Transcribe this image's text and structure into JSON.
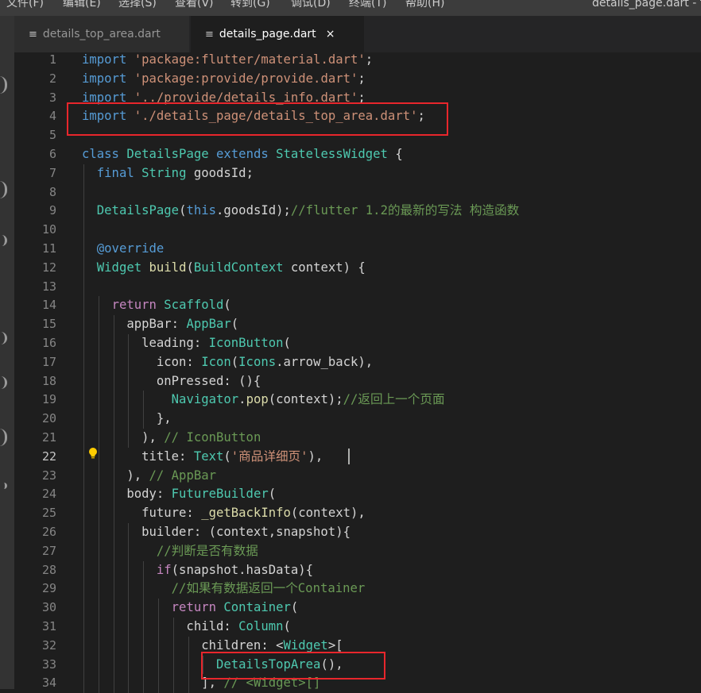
{
  "menu": {
    "items": [
      "文件(F)",
      "编辑(E)",
      "选择(S)",
      "查看(V)",
      "转到(G)",
      "调试(D)",
      "终端(T)",
      "帮助(H)"
    ],
    "window_title": "details_page.dart - flu"
  },
  "tabs": [
    {
      "label": "details_top_area.dart",
      "active": false
    },
    {
      "label": "details_page.dart",
      "active": true,
      "close": "×"
    }
  ],
  "editor": {
    "active_line": 22,
    "lines": [
      {
        "n": "1",
        "tokens": [
          [
            "import",
            "k"
          ],
          [
            " ",
            "p"
          ],
          [
            "'package:flutter/material.dart'",
            "s"
          ],
          [
            ";",
            "p"
          ]
        ]
      },
      {
        "n": "2",
        "tokens": [
          [
            "import",
            "k"
          ],
          [
            " ",
            "p"
          ],
          [
            "'package:provide/provide.dart'",
            "s"
          ],
          [
            ";",
            "p"
          ]
        ]
      },
      {
        "n": "3",
        "tokens": [
          [
            "import",
            "k"
          ],
          [
            " ",
            "p"
          ],
          [
            "'../provide/details_info.dart'",
            "s"
          ],
          [
            ";",
            "p"
          ]
        ]
      },
      {
        "n": "4",
        "tokens": [
          [
            "import",
            "k"
          ],
          [
            " ",
            "p"
          ],
          [
            "'./details_page/details_top_area.dart'",
            "s"
          ],
          [
            ";",
            "p"
          ]
        ]
      },
      {
        "n": "5",
        "tokens": []
      },
      {
        "n": "6",
        "tokens": [
          [
            "class",
            "k"
          ],
          [
            " ",
            "p"
          ],
          [
            "DetailsPage",
            "t"
          ],
          [
            " ",
            "p"
          ],
          [
            "extends",
            "k"
          ],
          [
            " ",
            "p"
          ],
          [
            "StatelessWidget",
            "t"
          ],
          [
            " {",
            "p"
          ]
        ]
      },
      {
        "n": "7",
        "tokens": [
          [
            "  ",
            "p"
          ],
          [
            "final",
            "k"
          ],
          [
            " ",
            "p"
          ],
          [
            "String",
            "t"
          ],
          [
            " goodsId;",
            "p"
          ]
        ]
      },
      {
        "n": "8",
        "tokens": []
      },
      {
        "n": "9",
        "tokens": [
          [
            "  ",
            "p"
          ],
          [
            "DetailsPage",
            "t"
          ],
          [
            "(",
            "p"
          ],
          [
            "this",
            "k"
          ],
          [
            ".goodsId);",
            "p"
          ],
          [
            "//flutter 1.2的最新的写法 构造函数",
            "c"
          ]
        ]
      },
      {
        "n": "10",
        "tokens": []
      },
      {
        "n": "11",
        "tokens": [
          [
            "  ",
            "p"
          ],
          [
            "@override",
            "k"
          ]
        ]
      },
      {
        "n": "12",
        "tokens": [
          [
            "  ",
            "p"
          ],
          [
            "Widget",
            "t"
          ],
          [
            " ",
            "p"
          ],
          [
            "build",
            "f"
          ],
          [
            "(",
            "p"
          ],
          [
            "BuildContext",
            "t"
          ],
          [
            " context) {",
            "p"
          ]
        ]
      },
      {
        "n": "13",
        "tokens": []
      },
      {
        "n": "14",
        "tokens": [
          [
            "    ",
            "p"
          ],
          [
            "return",
            "kc"
          ],
          [
            " ",
            "p"
          ],
          [
            "Scaffold",
            "t"
          ],
          [
            "(",
            "p"
          ]
        ]
      },
      {
        "n": "15",
        "tokens": [
          [
            "      appBar: ",
            "p"
          ],
          [
            "AppBar",
            "t"
          ],
          [
            "(",
            "p"
          ]
        ]
      },
      {
        "n": "16",
        "tokens": [
          [
            "        leading: ",
            "p"
          ],
          [
            "IconButton",
            "t"
          ],
          [
            "(",
            "p"
          ]
        ]
      },
      {
        "n": "17",
        "tokens": [
          [
            "          icon: ",
            "p"
          ],
          [
            "Icon",
            "t"
          ],
          [
            "(",
            "p"
          ],
          [
            "Icons",
            "t"
          ],
          [
            ".arrow_back),",
            "p"
          ]
        ]
      },
      {
        "n": "18",
        "tokens": [
          [
            "          onPressed: (){",
            "p"
          ]
        ]
      },
      {
        "n": "19",
        "tokens": [
          [
            "            ",
            "p"
          ],
          [
            "Navigator",
            "t"
          ],
          [
            ".",
            "p"
          ],
          [
            "pop",
            "f"
          ],
          [
            "(context);",
            "p"
          ],
          [
            "//返回上一个页面",
            "c"
          ]
        ]
      },
      {
        "n": "20",
        "tokens": [
          [
            "          },",
            "p"
          ]
        ]
      },
      {
        "n": "21",
        "tokens": [
          [
            "        ), ",
            "p"
          ],
          [
            "// IconButton",
            "c"
          ]
        ]
      },
      {
        "n": "22",
        "tokens": [
          [
            "        title: ",
            "p"
          ],
          [
            "Text",
            "t"
          ],
          [
            "(",
            "p"
          ],
          [
            "'商品详细页'",
            "s"
          ],
          [
            "),",
            "p"
          ]
        ]
      },
      {
        "n": "23",
        "tokens": [
          [
            "      ), ",
            "p"
          ],
          [
            "// AppBar",
            "c"
          ]
        ]
      },
      {
        "n": "24",
        "tokens": [
          [
            "      body: ",
            "p"
          ],
          [
            "FutureBuilder",
            "t"
          ],
          [
            "(",
            "p"
          ]
        ]
      },
      {
        "n": "25",
        "tokens": [
          [
            "        future: ",
            "p"
          ],
          [
            "_getBackInfo",
            "f"
          ],
          [
            "(context),",
            "p"
          ]
        ]
      },
      {
        "n": "26",
        "tokens": [
          [
            "        builder: (context,snapshot){",
            "p"
          ]
        ]
      },
      {
        "n": "27",
        "tokens": [
          [
            "          ",
            "p"
          ],
          [
            "//判断是否有数据",
            "c"
          ]
        ]
      },
      {
        "n": "28",
        "tokens": [
          [
            "          ",
            "p"
          ],
          [
            "if",
            "kc"
          ],
          [
            "(snapshot.hasData){",
            "p"
          ]
        ]
      },
      {
        "n": "29",
        "tokens": [
          [
            "            ",
            "p"
          ],
          [
            "//如果有数据返回一个Container",
            "c"
          ]
        ]
      },
      {
        "n": "30",
        "tokens": [
          [
            "            ",
            "p"
          ],
          [
            "return",
            "kc"
          ],
          [
            " ",
            "p"
          ],
          [
            "Container",
            "t"
          ],
          [
            "(",
            "p"
          ]
        ]
      },
      {
        "n": "31",
        "tokens": [
          [
            "              child: ",
            "p"
          ],
          [
            "Column",
            "t"
          ],
          [
            "(",
            "p"
          ]
        ]
      },
      {
        "n": "32",
        "tokens": [
          [
            "                children: <",
            "p"
          ],
          [
            "Widget",
            "t"
          ],
          [
            ">[",
            "p"
          ]
        ]
      },
      {
        "n": "33",
        "tokens": [
          [
            "                  ",
            "p"
          ],
          [
            "DetailsTopArea",
            "t"
          ],
          [
            "(),",
            "p"
          ]
        ]
      },
      {
        "n": "34",
        "tokens": [
          [
            "                ], ",
            "p"
          ],
          [
            "// <Widget>[]",
            "c"
          ]
        ]
      }
    ]
  },
  "colors": {
    "highlight_box": "#e8262c",
    "keyword": "#569cd6",
    "control_keyword": "#c586c0",
    "string": "#ce9178",
    "comment": "#6a9955",
    "type": "#4ec9b0",
    "function": "#dcdcaa"
  },
  "icons": {
    "file_icon": "≡",
    "lightbulb": "lightbulb-icon"
  }
}
